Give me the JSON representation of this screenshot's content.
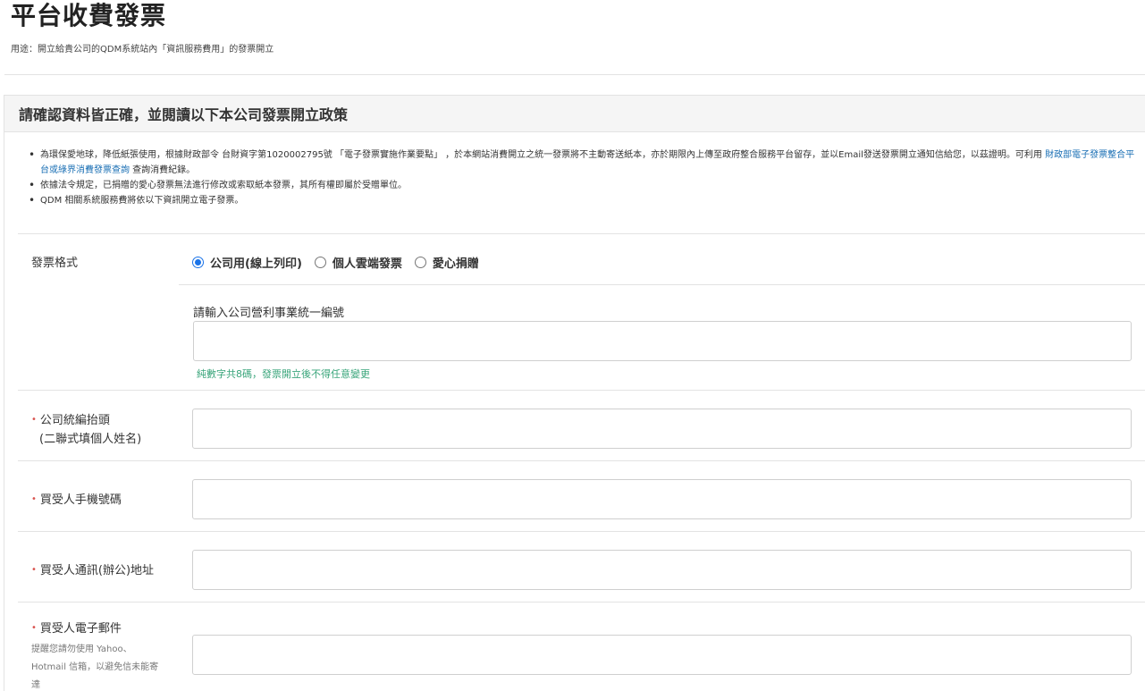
{
  "page": {
    "title": "平台收費發票",
    "subtitle": "用途：開立給貴公司的QDM系統站內「資訊服務費用」的發票開立"
  },
  "panel": {
    "heading": "請確認資料皆正確，並閱讀以下本公司發票開立政策"
  },
  "policy": {
    "item1_part1": "為環保愛地球，降低紙張使用，根據財政部令 台財資字第1020002795號 「電子發票實施作業要點」 ，於本網站消費開立之統一發票將不主動寄送紙本，亦於期限內上傳至政府整合服務平台留存，並以Email發送發票開立通知信給您，以茲證明。可利用 ",
    "item1_link": "財政部電子發票整合平台或綠界消費發票查詢",
    "item1_part2": " 查詢消費紀錄。",
    "item2": "依據法令規定，已捐贈的愛心發票無法進行修改或索取紙本發票，其所有權即屬於受贈單位。",
    "item3": "QDM 相關系統服務費將依以下資訊開立電子發票。"
  },
  "form": {
    "invoice_format_label": "發票格式",
    "radio_options": [
      "公司用(線上列印)",
      "個人雲端發票",
      "愛心捐贈"
    ],
    "selected_option": "公司用(線上列印)",
    "tax_id_label": "請輸入公司營利事業統一編號",
    "tax_id_value": "",
    "tax_id_hint": "純數字共8碼，發票開立後不得任意變更",
    "required_mark": "•",
    "company_title_label_line1": "公司統編抬頭",
    "company_title_label_line2": "(二聯式填個人姓名)",
    "company_title_value": "",
    "phone_label": "買受人手機號碼",
    "phone_value": "",
    "address_label": "買受人通訊(辦公)地址",
    "address_value": "",
    "email_label": "買受人電子郵件",
    "email_note": "提醒您請勿使用 Yahoo、Hotmail 信箱，以避免信未能寄達",
    "email_value": ""
  },
  "colors": {
    "required": "#d9534f",
    "hint": "#3aa57b",
    "link": "#1a6fb4",
    "radio_selected": "#1a73e8"
  }
}
